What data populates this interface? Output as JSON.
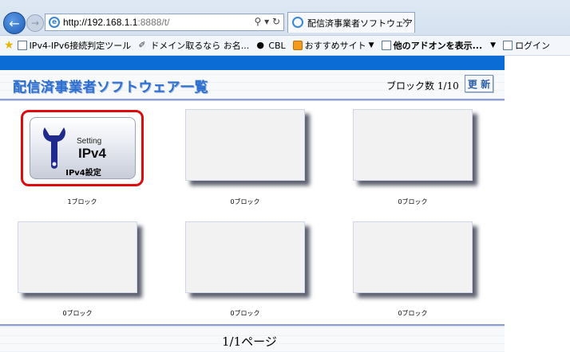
{
  "browser": {
    "url_host": "http://192.168.1.1",
    "url_rest": ":8888/t/",
    "tab_title": "配信済事業者ソフトウェア",
    "favorites": [
      {
        "label": "IPv4-IPv6接続判定ツール",
        "icon": "document-icon"
      },
      {
        "label": "ドメイン取るなら お名...",
        "icon": "onamae-icon"
      },
      {
        "label": "CBL",
        "icon": "cbl-icon"
      },
      {
        "label": "おすすめサイト",
        "icon": "orange-icon",
        "dropdown": true
      },
      {
        "label": "他のアドオンを表示...",
        "icon": "document-icon",
        "dropdown": true
      },
      {
        "label": "ログイン",
        "icon": "document-icon"
      }
    ]
  },
  "header": {
    "title": "配信済事業者ソフトウェア一覧",
    "block_count": "ブロック数 1/10",
    "refresh_label": "更 新"
  },
  "app_tile": {
    "setting_text": "Setting",
    "ipv4_text": "IPv4",
    "name": "IPv4設定"
  },
  "tiles": [
    {
      "label": "1ブロック"
    },
    {
      "label": "0ブロック"
    },
    {
      "label": "0ブロック"
    },
    {
      "label": "0ブロック"
    },
    {
      "label": "0ブロック"
    },
    {
      "label": "0ブロック"
    }
  ],
  "pager": {
    "text": "1/1ページ"
  },
  "colors": {
    "accent_blue": "#0a6cd4",
    "title_blue": "#2d6fd0",
    "highlight_red": "#dd0b0b"
  }
}
